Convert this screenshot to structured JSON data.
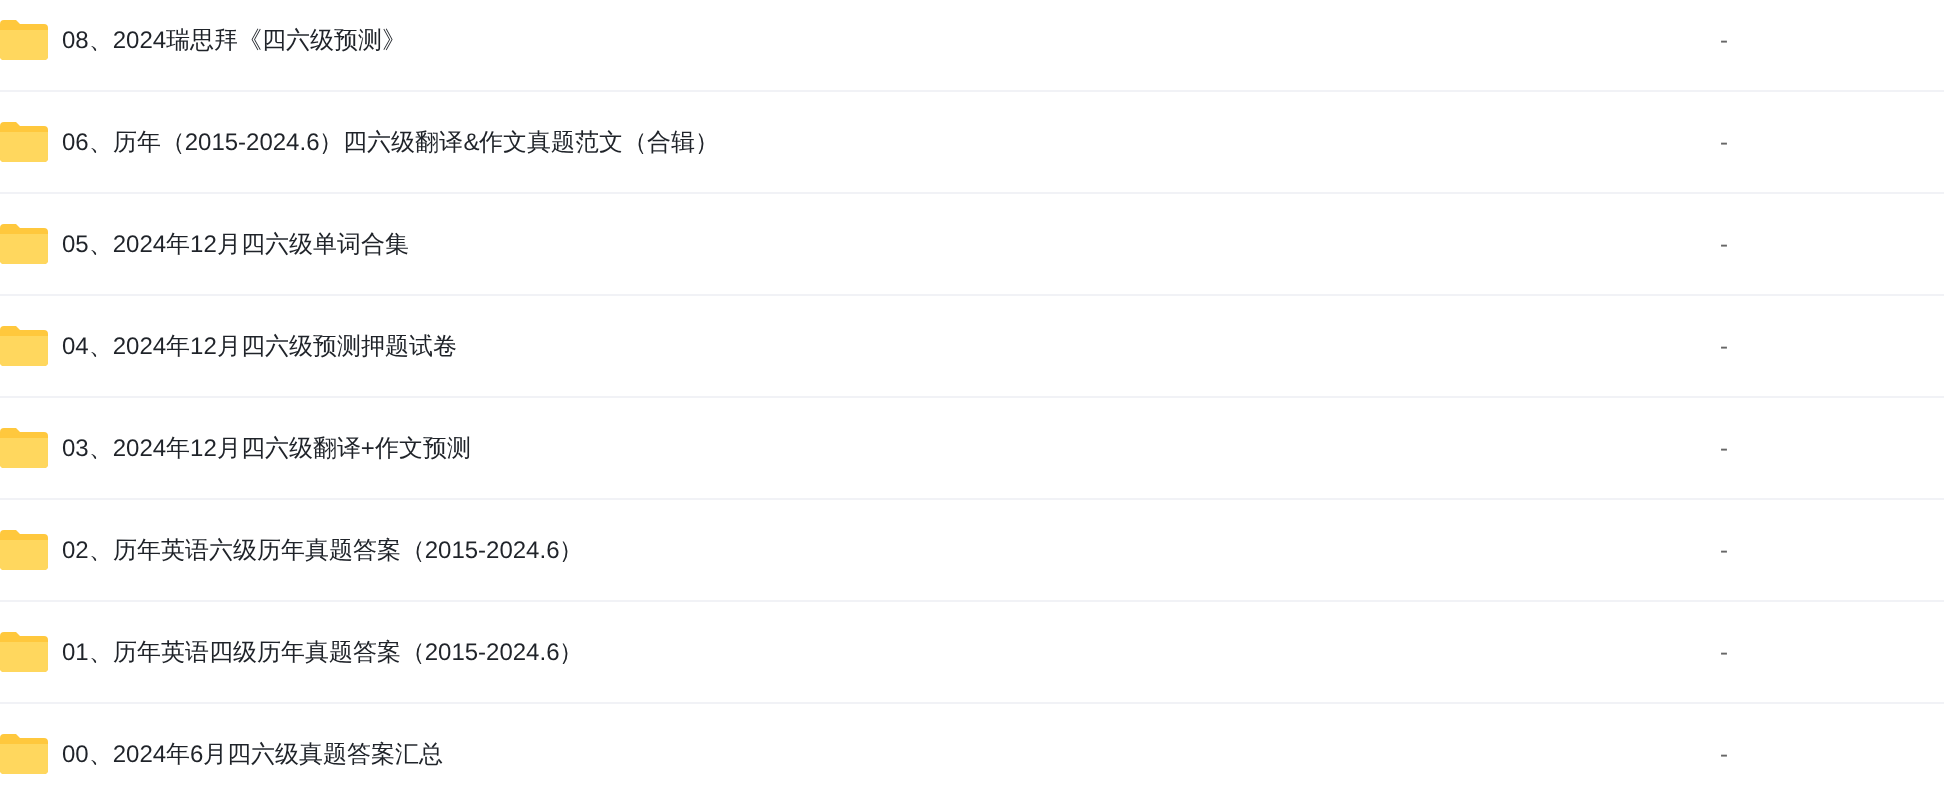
{
  "files": [
    {
      "name": "08、2024瑞思拜《四六级预测》",
      "size": "-"
    },
    {
      "name": "06、历年（2015-2024.6）四六级翻译&作文真题范文（合辑）",
      "size": "-"
    },
    {
      "name": "05、2024年12月四六级单词合集",
      "size": "-"
    },
    {
      "name": "04、2024年12月四六级预测押题试卷",
      "size": "-"
    },
    {
      "name": "03、2024年12月四六级翻译+作文预测",
      "size": "-"
    },
    {
      "name": "02、历年英语六级历年真题答案（2015-2024.6）",
      "size": "-"
    },
    {
      "name": "01、历年英语四级历年真题答案（2015-2024.6）",
      "size": "-"
    },
    {
      "name": "00、2024年6月四六级真题答案汇总",
      "size": "-"
    }
  ]
}
